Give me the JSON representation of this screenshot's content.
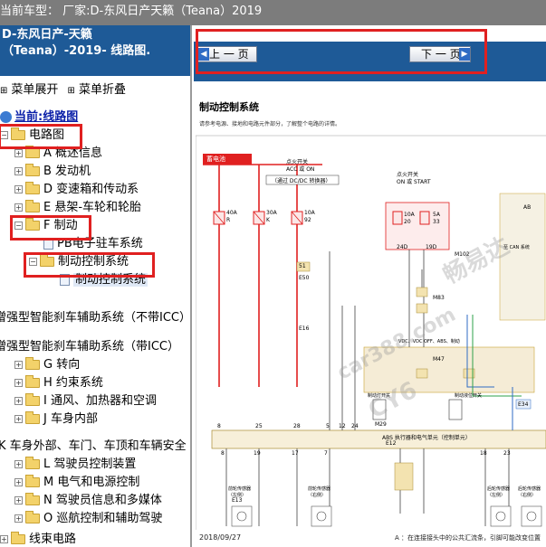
{
  "topbar": {
    "text": "当前车型： 厂家:D-东风日产天籁（Teana）2019"
  },
  "left": {
    "header_line1": "D-东风日产-天籁",
    "header_line2": "（Teana）-2019- 线路图.",
    "menu_expand": "菜单展开",
    "menu_collapse": "菜单折叠",
    "root_label": "当前:线路图",
    "tree": {
      "circuit": "电路图",
      "a": "A 概述信息",
      "b": "B 发动机",
      "d": "D 变速箱和传动系",
      "e": "E 悬架-车轮和轮胎",
      "f": "F 制动",
      "pb": "PB电子驻车系统",
      "brake_ctrl": "制动控制系统",
      "brake_ctrl_doc": "制动控制系统",
      "assist1": "增强型智能刹车辅助系统（不带ICC）",
      "assist2": "增强型智能刹车辅助系统（带ICC）",
      "g": "G 转向",
      "h": "H 约束系统",
      "i": "I 通风、加热器和空调",
      "j": "J 车身内部",
      "k": "K 车身外部、车门、车顶和车辆安全",
      "l": "L 驾驶员控制装置",
      "m": "M 电气和电源控制",
      "n": "N 驾驶员信息和多媒体",
      "o": "O 巡航控制和辅助驾驶",
      "harness": "线束电路"
    }
  },
  "nav": {
    "prev": "上 一 页",
    "next": "下 一 页"
  },
  "diagram": {
    "title": "制动控制系统",
    "note": "请参考电源、接地和电路元件部分，了解整个电路的详情。",
    "battery": "蓄电池",
    "ign_acc": "点火开关",
    "ign_acc2": "ACC 或 ON",
    "ign_acc3": "（通过 DC/DC 转换器）",
    "ign_start": "点火开关",
    "ign_start2": "ON 或 START",
    "fuse1": "40A",
    "fuse2": "30A",
    "fuse3": "10A",
    "fuse4": "10A",
    "fuse5": "5A",
    "fuse_r": "R",
    "fuse_k": "K",
    "fuse_92": "92",
    "fuse_20": "20",
    "fuse_33": "33",
    "conn_e50": "E50",
    "conn_51": "51",
    "conn_e16": "E16",
    "conn_24d": "24D",
    "conn_19d": "19D",
    "conn_m102": "M102",
    "conn_m83": "M83",
    "conn_m47": "M47",
    "conn_e12": "E12",
    "conn_e13": "E13",
    "conn_e34": "E34",
    "conn_m29": "M29",
    "abs_unit": "ABS 执行器和电气单元（控制单元）",
    "abs_pins": [
      "8",
      "25",
      "28",
      "5",
      "12",
      "24"
    ],
    "bottom_pins": [
      "8",
      "19",
      "17",
      "7",
      "18",
      "23"
    ],
    "sensor_fl": "前轮传感器（左侧）",
    "sensor_fr": "前轮传感器（右侧）",
    "sensor_rl": "后轮传感器（左侧）",
    "sensor_rr": "后轮传感器（右侧）",
    "stop_lamp": "制动灯开关",
    "can": "至 CAN 系统",
    "vdc": "VDC、VDC OFF、ABS、制动",
    "stop_sw": "制动液位开关",
    "ab_label": "AB",
    "date": "2018/09/27",
    "foot": "A ：在连接接头中的公共汇流条，引脚可能改变位置"
  },
  "watermark": [
    "畅易达",
    "car388.com",
    "CY6"
  ]
}
